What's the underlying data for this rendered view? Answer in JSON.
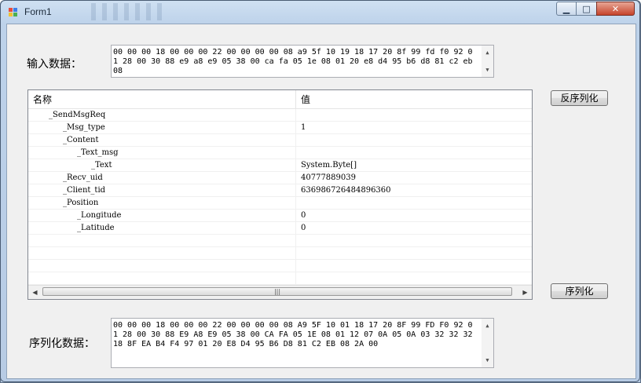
{
  "window": {
    "title": "Form1"
  },
  "caption_buttons": {
    "minimize": "▁",
    "maximize": "□",
    "close": "✕"
  },
  "input": {
    "label": "输入数据：",
    "value": "00 00 00 18 00 00 00 22 00 00 00 00 08 a9 5f 10 19 18 17 20 8f 99 fd f0 92 01 28 00 30 88 e9 a8 e9 05 38 00 ca fa 05 1e 08 01 20 e8 d4 95 b6 d8 81 c2 eb 08"
  },
  "buttons": {
    "deserialize": "反序列化",
    "serialize": "序列化"
  },
  "grid": {
    "headers": {
      "name": "名称",
      "value": "值"
    },
    "rows": [
      {
        "name": "_SendMsgReq",
        "value": "",
        "level": 0
      },
      {
        "name": "_Msg_type",
        "value": "1",
        "level": 1
      },
      {
        "name": "_Content",
        "value": "",
        "level": 1
      },
      {
        "name": "_Text_msg",
        "value": "",
        "level": 2
      },
      {
        "name": "_Text",
        "value": "System.Byte[]",
        "level": 3
      },
      {
        "name": "_Recv_uid",
        "value": "40777889039",
        "level": 1
      },
      {
        "name": "_Client_tid",
        "value": "636986726484896360",
        "level": 1
      },
      {
        "name": "_Position",
        "value": "",
        "level": 1
      },
      {
        "name": "_Longitude",
        "value": "0",
        "level": 2
      },
      {
        "name": "_Latitude",
        "value": "0",
        "level": 2
      },
      {
        "name": "",
        "value": "",
        "level": 0
      },
      {
        "name": "",
        "value": "",
        "level": 0
      },
      {
        "name": "",
        "value": "",
        "level": 0
      },
      {
        "name": "",
        "value": "",
        "level": 0
      }
    ],
    "hscroll_grip": "|||"
  },
  "output": {
    "label": "序列化数据：",
    "value": "00 00 00 18 00 00 00 22 00 00 00 00 08 A9 5F 10 01 18 17 20 8F 99 FD F0 92 01 28 00 30 88 E9 A8 E9 05 38 00 CA FA 05 1E 08 01 12 07 0A 05 0A 03 32 32 32 18 8F EA B4 F4 97 01 20 E8 D4 95 B6 D8 81 C2 EB 08 2A 00"
  },
  "colors": {
    "titlebar": "#bdd2ea",
    "client": "#f0f0f0",
    "close": "#c6442b"
  },
  "icons": [
    "app-icon",
    "minimize-icon",
    "maximize-icon",
    "close-icon",
    "scroll-up-icon",
    "scroll-down-icon",
    "scroll-left-icon",
    "scroll-right-icon"
  ]
}
